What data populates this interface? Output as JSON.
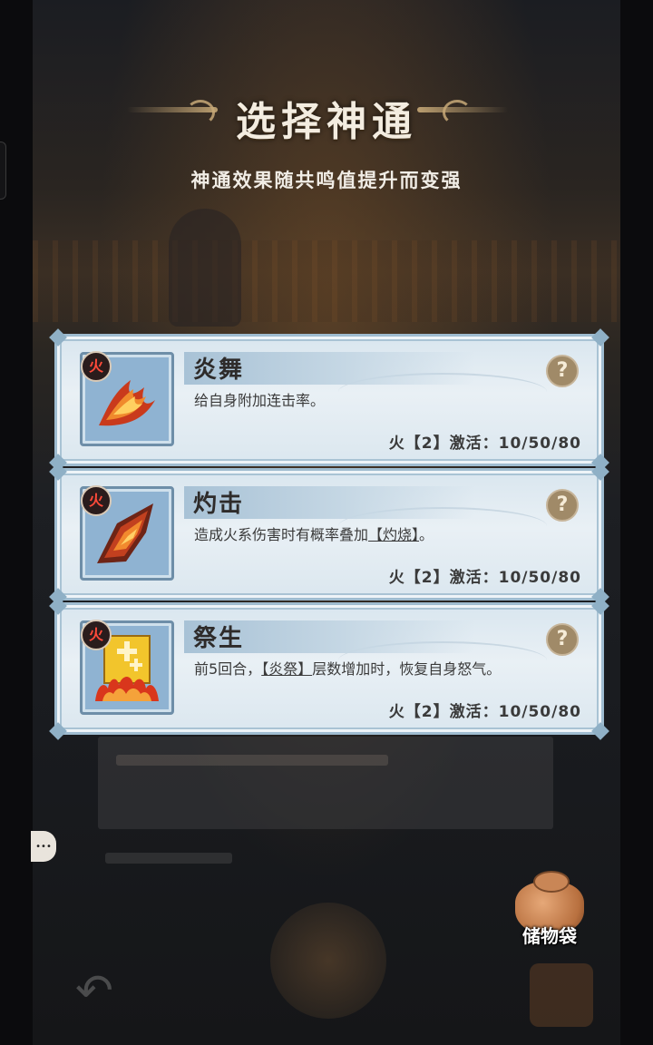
{
  "header": {
    "title": "选择神通",
    "subtitle": "神通效果随共鸣值提升而变强"
  },
  "element_badge": "火",
  "help_symbol": "?",
  "cards": [
    {
      "name": "炎舞",
      "desc_prefix": "给自身附加连击率。",
      "desc_keyword": "",
      "desc_suffix": "",
      "activation": "火【2】激活：10/50/80",
      "icon": "flame-claw-icon"
    },
    {
      "name": "灼击",
      "desc_prefix": "造成火系伤害时有概率叠加",
      "desc_keyword": "【灼烧】",
      "desc_suffix": "。",
      "activation": "火【2】激活：10/50/80",
      "icon": "flame-blade-icon"
    },
    {
      "name": "祭生",
      "desc_prefix": "前5回合，",
      "desc_keyword": "【炎祭】",
      "desc_suffix": "层数增加时，恢复自身怒气。",
      "activation": "火【2】激活：10/50/80",
      "icon": "fire-banner-icon"
    }
  ],
  "storage_bag": {
    "label": "储物袋"
  },
  "colors": {
    "card_bg": "#e3ecf3",
    "card_border": "#9fbcd0",
    "fire_badge": "#ff4a3a",
    "help_button": "#a08a68",
    "text_dark": "#3a3a3a"
  }
}
